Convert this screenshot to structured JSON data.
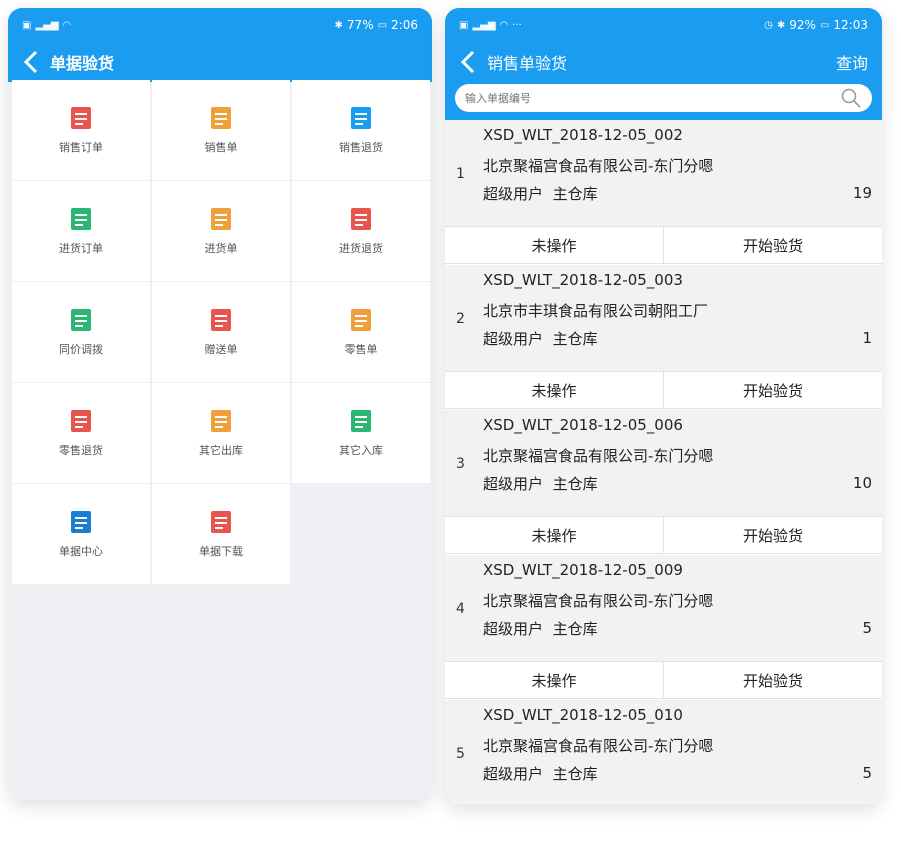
{
  "left": {
    "status": {
      "time": "2:06",
      "battery": "77%"
    },
    "title": "单据验货",
    "tiles": [
      {
        "label": "销售订单",
        "icon": "sales-order-icon",
        "color": "#e8554e"
      },
      {
        "label": "销售单",
        "icon": "sales-doc-icon",
        "color": "#f0a03a"
      },
      {
        "label": "销售退货",
        "icon": "sales-return-icon",
        "color": "#1a9cf0"
      },
      {
        "label": "进货订单",
        "icon": "purchase-order-icon",
        "color": "#2bb673"
      },
      {
        "label": "进货单",
        "icon": "purchase-doc-icon",
        "color": "#f0a03a"
      },
      {
        "label": "进货退货",
        "icon": "purchase-return-icon",
        "color": "#e8554e"
      },
      {
        "label": "同价调拨",
        "icon": "transfer-icon",
        "color": "#2bb673"
      },
      {
        "label": "赠送单",
        "icon": "gift-icon",
        "color": "#e8554e"
      },
      {
        "label": "零售单",
        "icon": "retail-icon",
        "color": "#f0a03a"
      },
      {
        "label": "零售退货",
        "icon": "retail-return-icon",
        "color": "#e8554e"
      },
      {
        "label": "其它出库",
        "icon": "stock-out-icon",
        "color": "#f0a03a"
      },
      {
        "label": "其它入库",
        "icon": "stock-in-icon",
        "color": "#2bb673"
      },
      {
        "label": "单据中心",
        "icon": "doc-center-icon",
        "color": "#1a7fd0"
      },
      {
        "label": "单据下载",
        "icon": "doc-download-icon",
        "color": "#e8554e"
      }
    ]
  },
  "right": {
    "status": {
      "time": "12:03",
      "battery": "92%"
    },
    "title": "销售单验货",
    "query_label": "查询",
    "search_placeholder": "输入单据编号",
    "orders": [
      {
        "index": "1",
        "code": "XSD_WLT_2018-12-05_002",
        "company": "北京聚福宫食品有限公司-东门分嗯",
        "user": "超级用户",
        "warehouse": "主仓库",
        "qty": "19",
        "status": "未操作",
        "action": "开始验货"
      },
      {
        "index": "2",
        "code": "XSD_WLT_2018-12-05_003",
        "company": "北京市丰琪食品有限公司朝阳工厂",
        "user": "超级用户",
        "warehouse": "主仓库",
        "qty": "1",
        "status": "未操作",
        "action": "开始验货"
      },
      {
        "index": "3",
        "code": "XSD_WLT_2018-12-05_006",
        "company": "北京聚福宫食品有限公司-东门分嗯",
        "user": "超级用户",
        "warehouse": "主仓库",
        "qty": "10",
        "status": "未操作",
        "action": "开始验货"
      },
      {
        "index": "4",
        "code": "XSD_WLT_2018-12-05_009",
        "company": "北京聚福宫食品有限公司-东门分嗯",
        "user": "超级用户",
        "warehouse": "主仓库",
        "qty": "5",
        "status": "未操作",
        "action": "开始验货"
      },
      {
        "index": "5",
        "code": "XSD_WLT_2018-12-05_010",
        "company": "北京聚福宫食品有限公司-东门分嗯",
        "user": "超级用户",
        "warehouse": "主仓库",
        "qty": "5"
      }
    ]
  },
  "theme": {
    "accent": "#1a9cf0"
  }
}
